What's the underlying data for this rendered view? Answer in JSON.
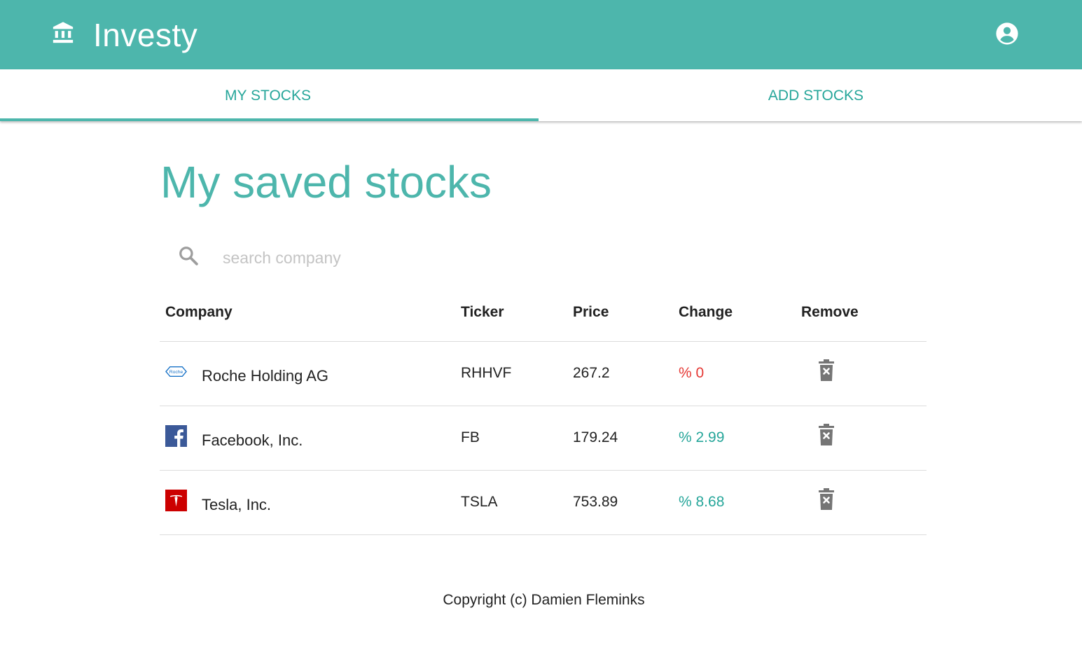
{
  "app": {
    "title": "Investy",
    "brand_icon": "bank-icon",
    "account_icon": "account-circle-icon",
    "primary_color": "#4db6ac",
    "accent_color": "#26a69a"
  },
  "tabs": [
    {
      "label": "MY STOCKS",
      "active": true
    },
    {
      "label": "ADD STOCKS",
      "active": false
    }
  ],
  "main": {
    "heading": "My saved stocks",
    "search": {
      "placeholder": "search company",
      "value": "",
      "icon": "search-icon"
    }
  },
  "table": {
    "headers": [
      "Company",
      "Ticker",
      "Price",
      "Change",
      "Remove"
    ],
    "rows": [
      {
        "logo": "roche-logo",
        "company": "Roche Holding AG",
        "ticker": "RHHVF",
        "price": "267.2",
        "change": "% 0",
        "change_color": "#e53935"
      },
      {
        "logo": "facebook-logo",
        "company": "Facebook, Inc.",
        "ticker": "FB",
        "price": "179.24",
        "change": "% 2.99",
        "change_color": "#26a69a"
      },
      {
        "logo": "tesla-logo",
        "company": "Tesla, Inc.",
        "ticker": "TSLA",
        "price": "753.89",
        "change": "% 8.68",
        "change_color": "#26a69a"
      }
    ],
    "remove_icon": "delete-forever-icon"
  },
  "footer": {
    "text": "Copyright (c) Damien Fleminks"
  }
}
